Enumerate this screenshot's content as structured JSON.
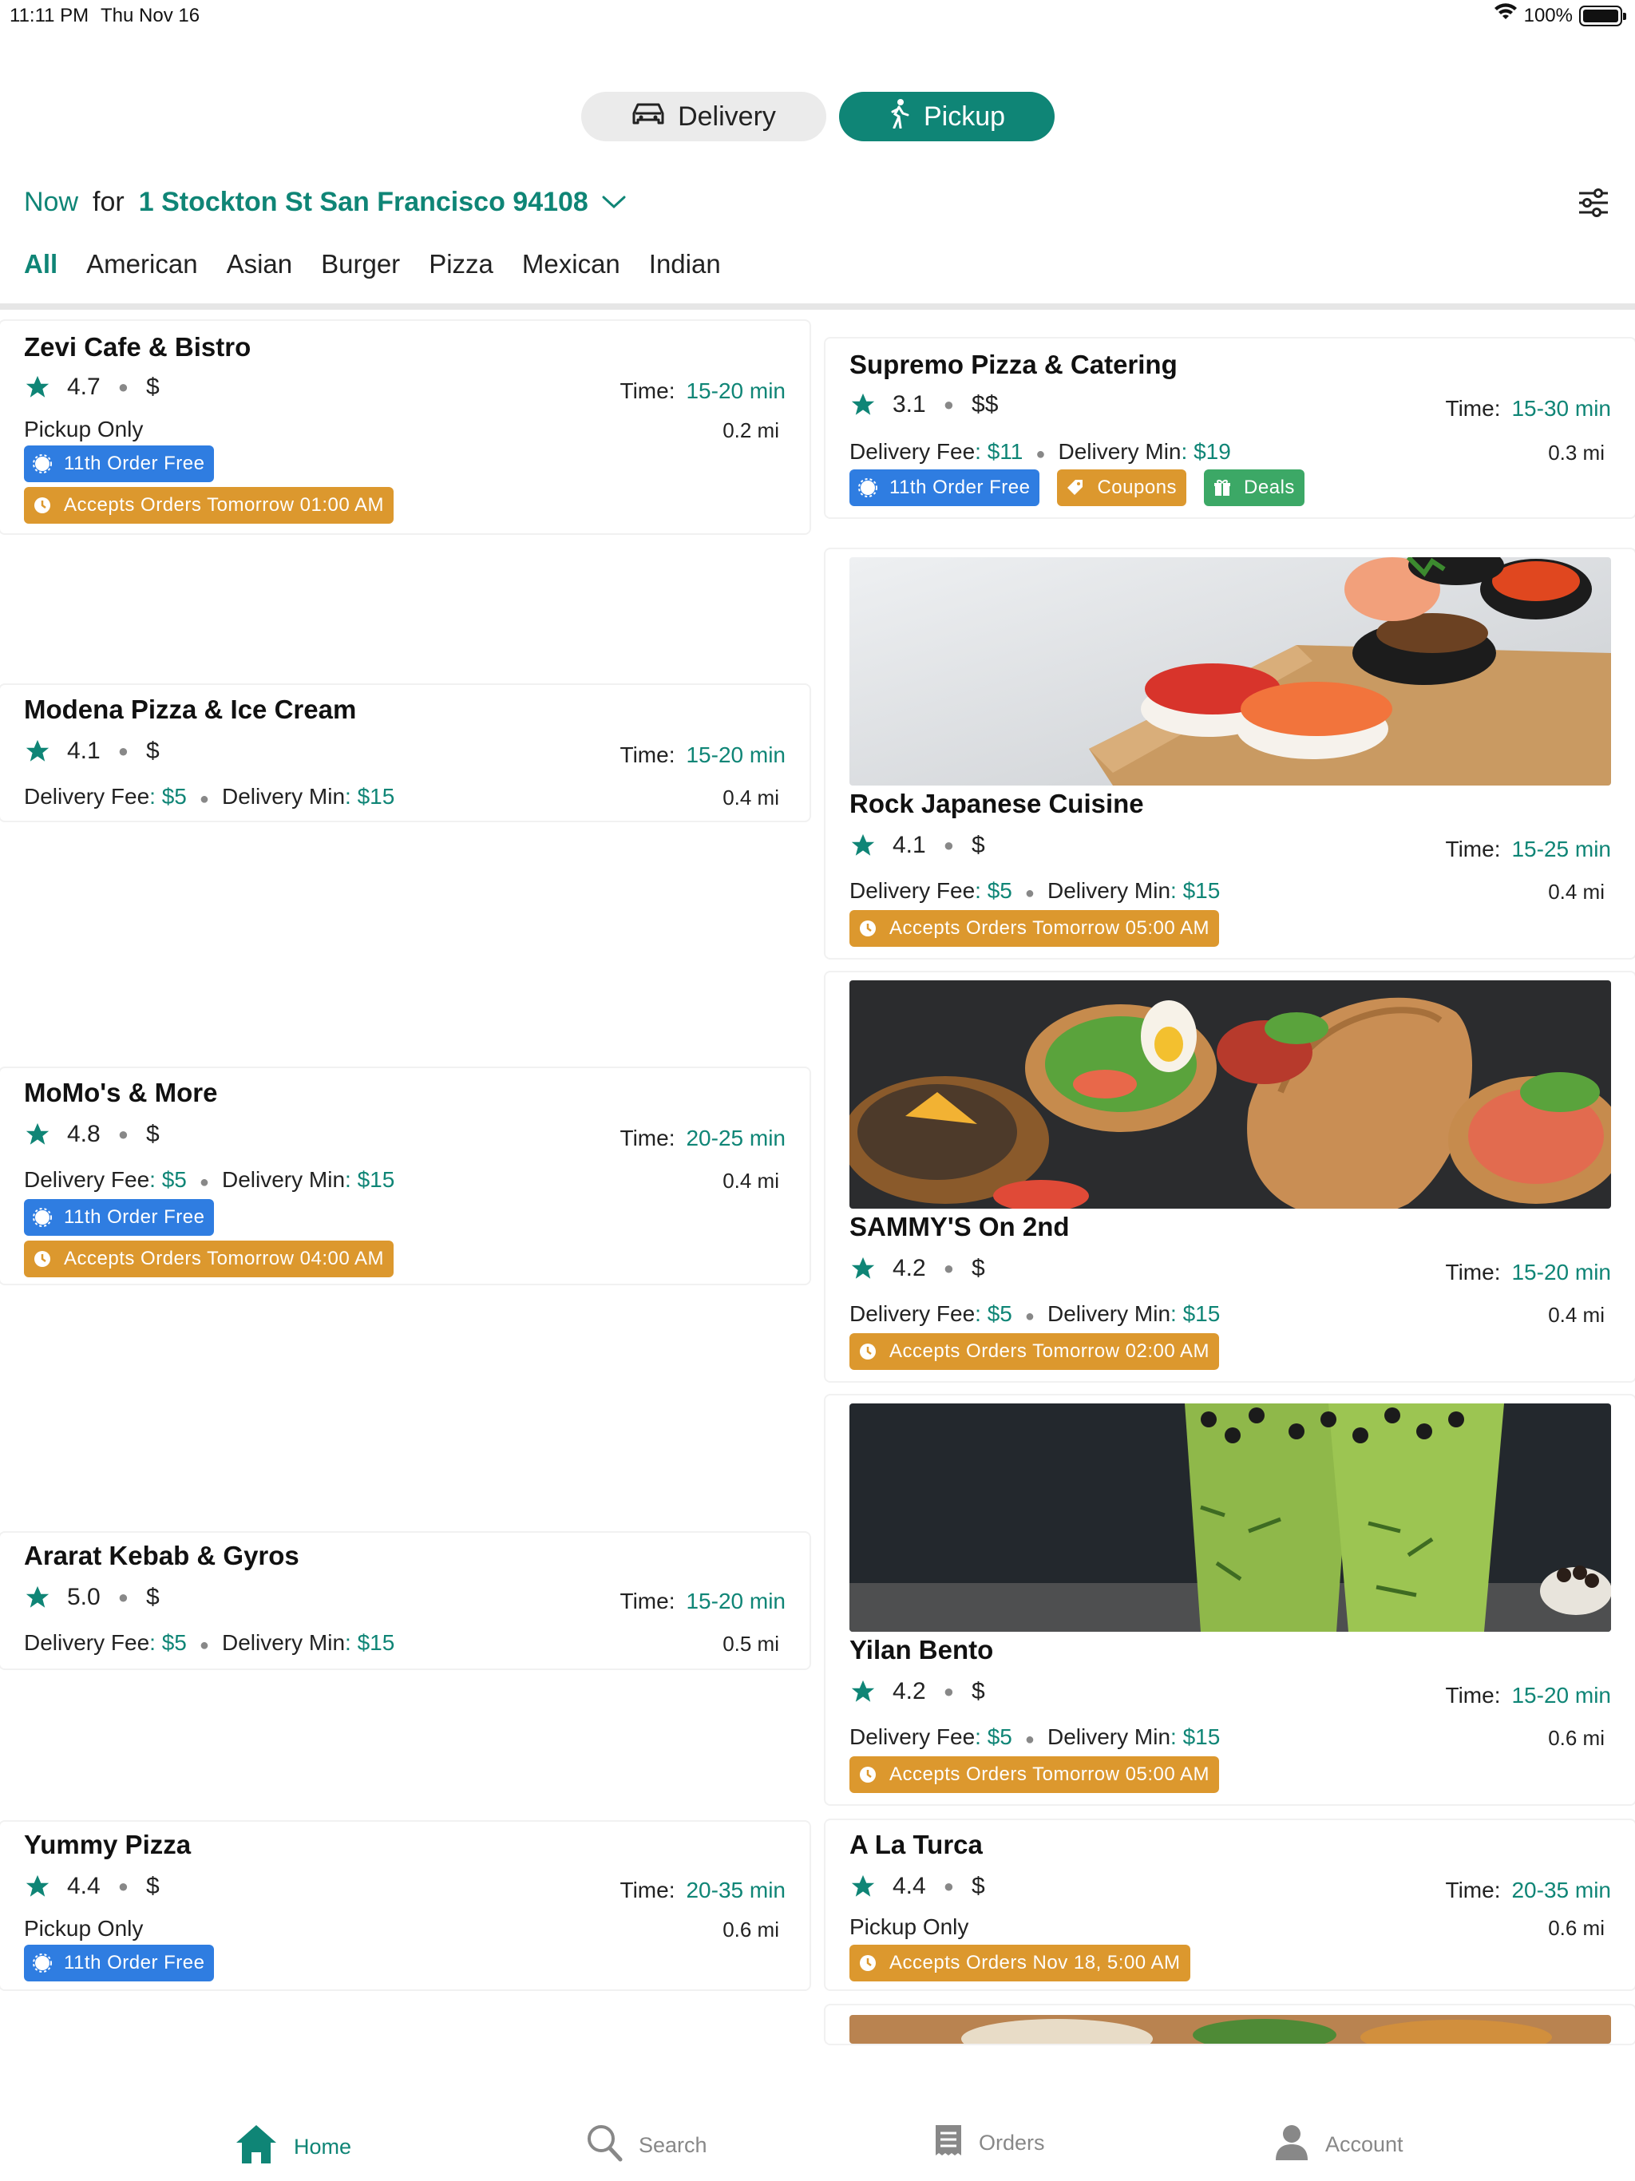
{
  "status": {
    "time": "11:11 PM",
    "date": "Thu Nov 16",
    "battery": "100%"
  },
  "mode": {
    "delivery_label": "Delivery",
    "pickup_label": "Pickup",
    "selected": "Pickup"
  },
  "location": {
    "when": "Now",
    "for_text": "for",
    "address": "1 Stockton St San Francisco 94108"
  },
  "categories": [
    "All",
    "American",
    "Asian",
    "Burger",
    "Pizza",
    "Mexican",
    "Indian"
  ],
  "labels": {
    "time": "Time:",
    "delivery_fee": "Delivery Fee",
    "delivery_min": "Delivery Min",
    "colon": ":"
  },
  "restaurants": {
    "zevi": {
      "name": "Zevi Cafe & Bistro",
      "rating": "4.7",
      "price": "$",
      "time": "15-20 min",
      "distance": "0.2 mi",
      "mode": "Pickup Only",
      "badge1": "11th Order Free",
      "badge2": "Accepts Orders Tomorrow 01:00 AM"
    },
    "supremo": {
      "name": "Supremo Pizza & Catering",
      "rating": "3.1",
      "price": "$$",
      "time": "15-30 min",
      "distance": "0.3 mi",
      "fee": "$11",
      "min": "$19",
      "badge1": "11th Order Free",
      "badge2": "Coupons",
      "badge3": "Deals"
    },
    "modena": {
      "name": "Modena Pizza & Ice Cream",
      "rating": "4.1",
      "price": "$",
      "time": "15-20 min",
      "distance": "0.4 mi",
      "fee": "$5",
      "min": "$15"
    },
    "rock": {
      "name": "Rock Japanese Cuisine",
      "rating": "4.1",
      "price": "$",
      "time": "15-25 min",
      "distance": "0.4 mi",
      "fee": "$5",
      "min": "$15",
      "badge1": "Accepts Orders Tomorrow 05:00 AM"
    },
    "momo": {
      "name": "MoMo's & More",
      "rating": "4.8",
      "price": "$",
      "time": "20-25 min",
      "distance": "0.4 mi",
      "fee": "$5",
      "min": "$15",
      "badge1": "11th Order Free",
      "badge2": "Accepts Orders Tomorrow 04:00 AM"
    },
    "sammy": {
      "name": "SAMMY'S On 2nd",
      "rating": "4.2",
      "price": "$",
      "time": "15-20 min",
      "distance": "0.4 mi",
      "fee": "$5",
      "min": "$15",
      "badge1": "Accepts Orders Tomorrow 02:00 AM"
    },
    "ararat": {
      "name": "Ararat Kebab & Gyros",
      "rating": "5.0",
      "price": "$",
      "time": "15-20 min",
      "distance": "0.5 mi",
      "fee": "$5",
      "min": "$15"
    },
    "yilan": {
      "name": "Yilan Bento",
      "rating": "4.2",
      "price": "$",
      "time": "15-20 min",
      "distance": "0.6 mi",
      "fee": "$5",
      "min": "$15",
      "badge1": "Accepts Orders Tomorrow 05:00 AM"
    },
    "yummy": {
      "name": "Yummy Pizza",
      "rating": "4.4",
      "price": "$",
      "time": "20-35 min",
      "distance": "0.6 mi",
      "mode": "Pickup Only",
      "badge1": "11th Order Free"
    },
    "alaturca": {
      "name": "A La Turca",
      "rating": "4.4",
      "price": "$",
      "time": "20-35 min",
      "distance": "0.6 mi",
      "mode": "Pickup Only",
      "badge1": "Accepts Orders Nov 18, 5:00 AM"
    }
  },
  "tabs": {
    "home": "Home",
    "search": "Search",
    "orders": "Orders",
    "account": "Account",
    "selected": "Home"
  },
  "colors": {
    "accent": "#0f8576",
    "blue_badge": "#2f7de1",
    "orange_badge": "#dc982e",
    "green_badge": "#3ca866"
  }
}
